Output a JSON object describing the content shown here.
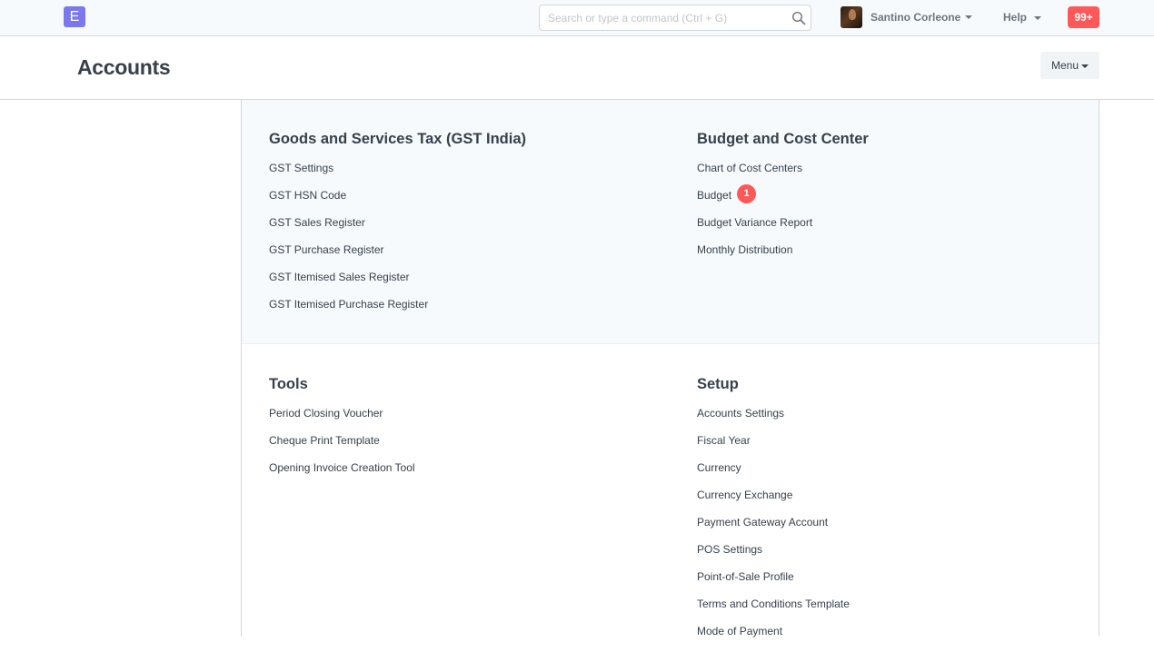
{
  "navbar": {
    "brand_letter": "E",
    "search_placeholder": "Search or type a command (Ctrl + G)",
    "user_name": "Santino Corleone",
    "help_label": "Help",
    "notifications_count": "99+"
  },
  "page": {
    "title": "Accounts",
    "menu_label": "Menu"
  },
  "sections": {
    "gst": {
      "title": "Goods and Services Tax (GST India)",
      "items": [
        "GST Settings",
        "GST HSN Code",
        "GST Sales Register",
        "GST Purchase Register",
        "GST Itemised Sales Register",
        "GST Itemised Purchase Register"
      ]
    },
    "budget": {
      "title": "Budget and Cost Center",
      "items": [
        "Chart of Cost Centers",
        "Budget",
        "Budget Variance Report",
        "Monthly Distribution"
      ],
      "budget_count": "1"
    },
    "tools": {
      "title": "Tools",
      "items": [
        "Period Closing Voucher",
        "Cheque Print Template",
        "Opening Invoice Creation Tool"
      ]
    },
    "setup": {
      "title": "Setup",
      "items": [
        "Accounts Settings",
        "Fiscal Year",
        "Currency",
        "Currency Exchange",
        "Payment Gateway Account",
        "POS Settings",
        "Point-of-Sale Profile",
        "Terms and Conditions Template",
        "Mode of Payment"
      ]
    }
  },
  "colors": {
    "brand": "#7b78ee",
    "badge": "#ff5858",
    "text": "#36414c",
    "muted": "#6c7680",
    "panel_bg": "#f7fafc",
    "border": "#d1d8dd"
  }
}
